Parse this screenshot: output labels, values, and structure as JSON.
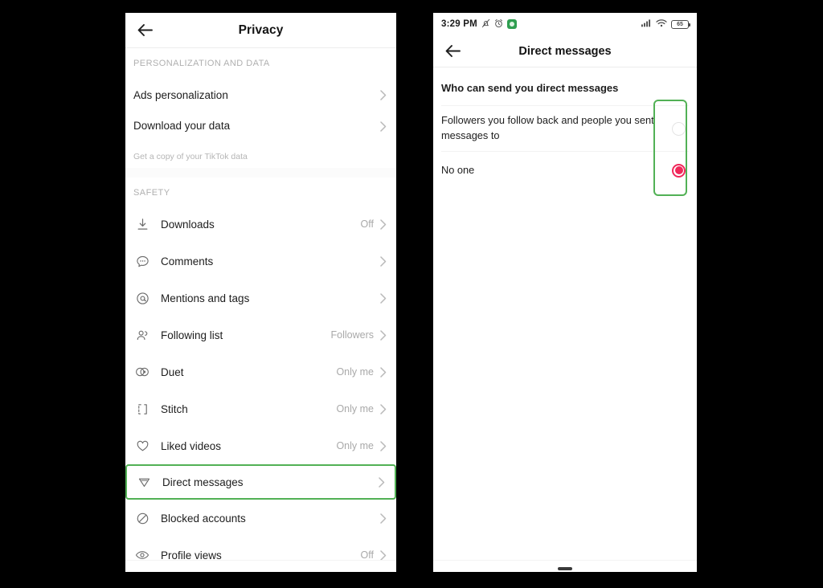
{
  "privacy_screen": {
    "back_icon": "arrow-left-icon",
    "title": "Privacy",
    "sections": [
      {
        "label": "PERSONALIZATION AND DATA",
        "items": [
          {
            "icon": "",
            "label": "Ads personalization",
            "value": "",
            "sub": "",
            "chevron": "›"
          },
          {
            "icon": "",
            "label": "Download your data",
            "value": "",
            "sub": "Get a copy of your TikTok data",
            "chevron": "›"
          }
        ]
      },
      {
        "label": "SAFETY",
        "items": [
          {
            "icon": "download-icon",
            "label": "Downloads",
            "value": "Off",
            "sub": "",
            "chevron": "›"
          },
          {
            "icon": "comment-bubble-icon",
            "label": "Comments",
            "value": "",
            "sub": "",
            "chevron": "›"
          },
          {
            "icon": "at-mention-icon",
            "label": "Mentions and tags",
            "value": "",
            "sub": "",
            "chevron": "›"
          },
          {
            "icon": "people-icon",
            "label": "Following list",
            "value": "Followers",
            "sub": "",
            "chevron": "›"
          },
          {
            "icon": "duet-icon",
            "label": "Duet",
            "value": "Only me",
            "sub": "",
            "chevron": "›"
          },
          {
            "icon": "stitch-icon",
            "label": "Stitch",
            "value": "Only me",
            "sub": "",
            "chevron": "›"
          },
          {
            "icon": "heart-icon",
            "label": "Liked videos",
            "value": "Only me",
            "sub": "",
            "chevron": "›"
          },
          {
            "icon": "paper-plane-icon",
            "label": "Direct messages",
            "value": "",
            "sub": "",
            "chevron": "›"
          },
          {
            "icon": "block-icon",
            "label": "Blocked accounts",
            "value": "",
            "sub": "",
            "chevron": "›"
          },
          {
            "icon": "eye-icon",
            "label": "Profile views",
            "value": "Off",
            "sub": "",
            "chevron": "›"
          }
        ]
      }
    ]
  },
  "dm_screen": {
    "statusbar": {
      "time": "3:29 PM",
      "mute_icon": "bell-muted-icon",
      "alarm_icon": "alarm-clock-icon",
      "app_icon": "green-app-icon",
      "signal_icon": "signal-bars-icon",
      "wifi_icon": "wifi-icon",
      "battery_level": "65"
    },
    "back_icon": "arrow-left-icon",
    "title": "Direct messages",
    "section_title": "Who can send you direct messages",
    "options": [
      {
        "label": "Followers you follow back and people you sent messages to",
        "selected": false
      },
      {
        "label": "No one",
        "selected": true
      }
    ]
  },
  "highlights": {
    "accent_green": "#52b155",
    "radio_selected_color": "#f0285a",
    "targets": [
      "direct-messages-row",
      "dm-radio-column"
    ]
  }
}
